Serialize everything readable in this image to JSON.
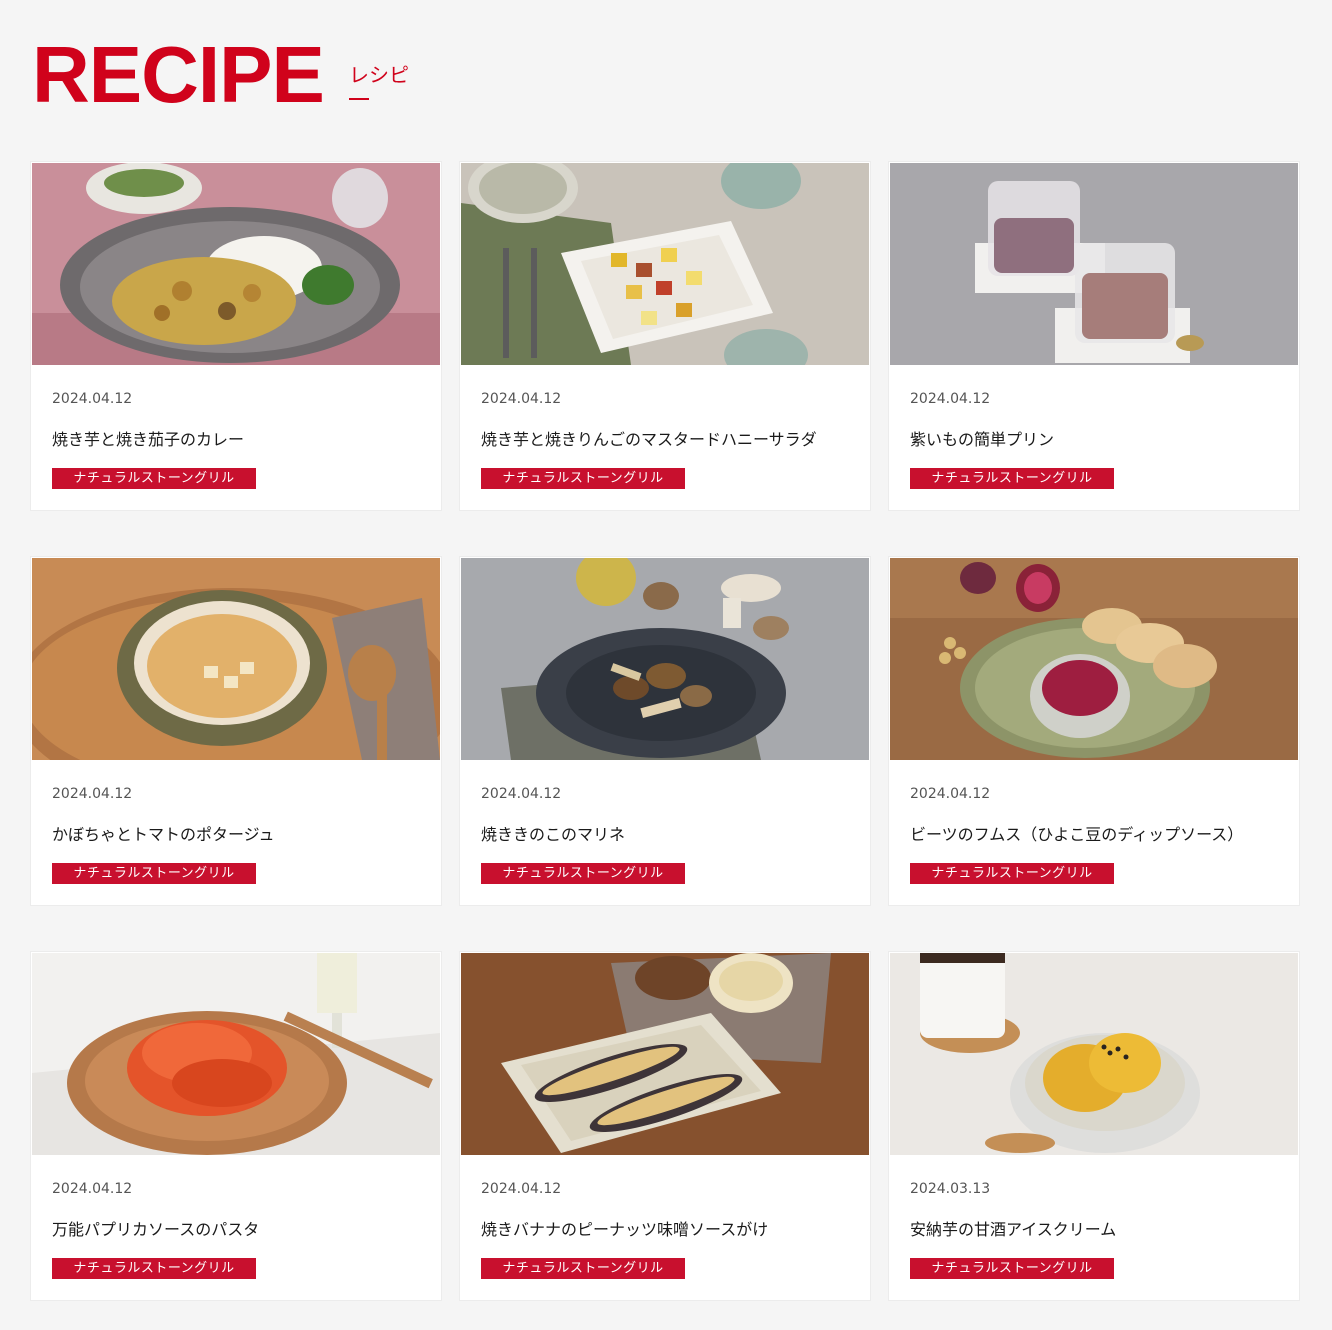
{
  "header": {
    "title": "RECIPE",
    "subtitle": "レシピ"
  },
  "recipes": [
    {
      "date": "2024.04.12",
      "title": "焼き芋と焼き茄子のカレー",
      "tag": "ナチュラルストーングリル",
      "image": "curry-photo"
    },
    {
      "date": "2024.04.12",
      "title": "焼き芋と焼きりんごのマスタードハニーサラダ",
      "tag": "ナチュラルストーングリル",
      "image": "salad-photo"
    },
    {
      "date": "2024.04.12",
      "title": "紫いもの簡単プリン",
      "tag": "ナチュラルストーングリル",
      "image": "pudding-photo"
    },
    {
      "date": "2024.04.12",
      "title": "かぼちゃとトマトのポタージュ",
      "tag": "ナチュラルストーングリル",
      "image": "soup-photo"
    },
    {
      "date": "2024.04.12",
      "title": "焼ききのこのマリネ",
      "tag": "ナチュラルストーングリル",
      "image": "mushroom-photo"
    },
    {
      "date": "2024.04.12",
      "title": "ビーツのフムス（ひよこ豆のディップソース）",
      "tag": "ナチュラルストーングリル",
      "image": "hummus-photo"
    },
    {
      "date": "2024.04.12",
      "title": "万能パプリカソースのパスタ",
      "tag": "ナチュラルストーングリル",
      "image": "pasta-photo"
    },
    {
      "date": "2024.04.12",
      "title": "焼きバナナのピーナッツ味噌ソースがけ",
      "tag": "ナチュラルストーングリル",
      "image": "banana-photo"
    },
    {
      "date": "2024.03.13",
      "title": "安納芋の甘酒アイスクリーム",
      "tag": "ナチュラルストーングリル",
      "image": "icecream-photo"
    }
  ],
  "colors": {
    "accent": "#d0021b",
    "tag_background": "#c8102e",
    "page_background": "#f5f5f5"
  }
}
